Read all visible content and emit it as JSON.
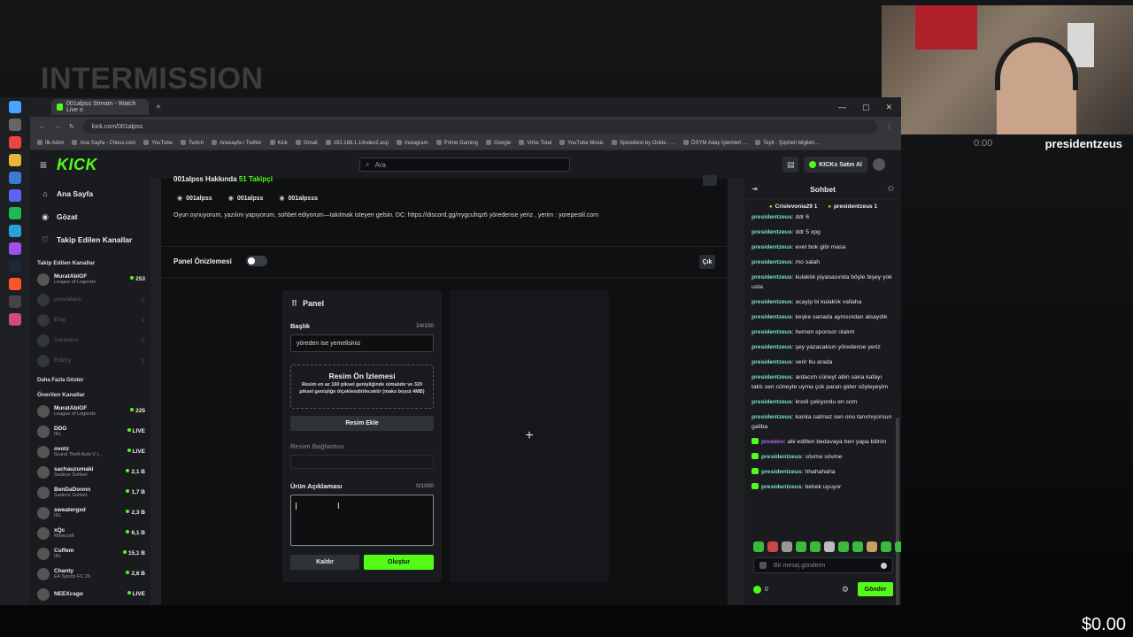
{
  "overlay": {
    "intermission": "INTERMISSION",
    "cam_time": "0:00",
    "cam_name": "presidentzeus",
    "money": "$0.00"
  },
  "browser": {
    "tab_title": "001alpss Stream - Watch Live o",
    "url": "kick.com/001alpss",
    "bookmarks": [
      "İlk Adım",
      "Ana Sayfa - Chess.com",
      "YouTube",
      "Twitch",
      "Anasayfa / Twitter",
      "Kick",
      "Gmail",
      "192.168.1.1/index2.asp",
      "Instagram",
      "Prime Gaming",
      "Google",
      "Virüs Total",
      "YouTube Music",
      "Speedtest by Ookla - ...",
      "ÖSYM Aday İşlemleri ...",
      "Teyit - Şüpheli bilgilen..."
    ]
  },
  "header": {
    "logo": "KICK",
    "search_placeholder": "Ara",
    "buy_label": "KICKs Satın Al"
  },
  "sidebar": {
    "nav": [
      {
        "icon": "⌂",
        "label": "Ana Sayfa"
      },
      {
        "icon": "◉",
        "label": "Gözat"
      },
      {
        "icon": "♡",
        "label": "Takip Edilen Kanallar"
      }
    ],
    "followed_title": "Takip Edilen Kanallar",
    "followed": [
      {
        "name": "MuratAbiGF",
        "game": "League of Legends",
        "viewers": "253",
        "live": true
      },
      {
        "name": "umurafann",
        "game": "",
        "viewers": "⚲",
        "live": false
      },
      {
        "name": "Ersy",
        "game": "",
        "viewers": "⚲",
        "live": false
      },
      {
        "name": "Saracens",
        "game": "",
        "viewers": "⚲",
        "live": false
      },
      {
        "name": "Erlizzy",
        "game": "",
        "viewers": "⚲",
        "live": false
      }
    ],
    "more": "Daha Fazla Göster",
    "recommended_title": "Önerilen Kanallar",
    "recommended": [
      {
        "name": "MuratAbiGF",
        "game": "League of Legends",
        "viewers": "225"
      },
      {
        "name": "DDG",
        "game": "IRL",
        "viewers": "LIVE"
      },
      {
        "name": "ovotz",
        "game": "Grand Theft Auto V (...",
        "viewers": "LIVE"
      },
      {
        "name": "sachauzumaki",
        "game": "Sadece Sohbet",
        "viewers": "2,1 B"
      },
      {
        "name": "BenDaDonnn",
        "game": "Sadece Sohbet",
        "viewers": "1,7 B"
      },
      {
        "name": "sweatergxd",
        "game": "IRL",
        "viewers": "2,3 B"
      },
      {
        "name": "xQc",
        "game": "Minecraft",
        "viewers": "6,1 B"
      },
      {
        "name": "Cuffem",
        "game": "IRL",
        "viewers": "15,1 B"
      },
      {
        "name": "Chanty",
        "game": "EA Sports FC 26",
        "viewers": "2,6 B"
      },
      {
        "name": "NEEXcsgo",
        "game": "",
        "viewers": "LIVE"
      }
    ]
  },
  "about": {
    "title": "001alpss Hakkında",
    "followers": "51 Takipçi",
    "socials": [
      "001alpss",
      "001alpss",
      "001alpsss"
    ],
    "bio": "Oyun oynuyorum, yazılım yapıyorum, sohbet ediyorum—takılmak isteyen gelsin. DC: https://discord.gg/rrygcuhqz6 yöredense yeriz , yerim : yorepestil.com"
  },
  "panel_preview": {
    "label": "Panel Önizlemesi",
    "exit": "Çık"
  },
  "editor": {
    "title": "Panel",
    "title_label": "Başlık",
    "title_count": "24/100",
    "title_value": "yöreden ise yemelisiniz",
    "image_preview_title": "Resim Ön İzlemesi",
    "image_preview_desc": "Resim en az 160 piksel genişliğinde olmalıdır ve 320 piksel genişliğe ölçeklendirilecektir (maks boyut 4MB)",
    "add_image": "Resim Ekle",
    "image_link_label": "Resim Bağlantısı",
    "desc_label": "Ürün Açıklaması",
    "desc_count": "0/1000",
    "remove": "Kaldır",
    "create": "Oluştur",
    "add_panel": "+"
  },
  "chat": {
    "title": "Sohbet",
    "pinned": [
      "Crislevonia29 1",
      "presidentzeus 1"
    ],
    "messages": [
      {
        "user": "presidentzeus",
        "text": "ddr 6",
        "badge": false,
        "purple": false
      },
      {
        "user": "presidentzeus",
        "text": "ddr 5 xpg",
        "badge": false,
        "purple": false
      },
      {
        "user": "presidentzeus",
        "text": "evet bok gibi masa",
        "badge": false,
        "purple": false
      },
      {
        "user": "presidentzeus",
        "text": "mo salah",
        "badge": false,
        "purple": false
      },
      {
        "user": "presidentzeus",
        "text": "kulaklık piyasasında böyle bişey yok usta",
        "badge": false,
        "purple": false
      },
      {
        "user": "presidentzeus",
        "text": "acayip bi kulaklık vallaha",
        "badge": false,
        "purple": false
      },
      {
        "user": "presidentzeus",
        "text": "keşke sanada aynısından alsaydık",
        "badge": false,
        "purple": false
      },
      {
        "user": "presidentzeus",
        "text": "hemen sponsor olalım",
        "badge": false,
        "purple": false
      },
      {
        "user": "presidentzeus",
        "text": "şey yazacaksın yöredense yeriz",
        "badge": false,
        "purple": false
      },
      {
        "user": "presidentzeus",
        "text": "verir bu arada",
        "badge": false,
        "purple": false
      },
      {
        "user": "presidentzeus",
        "text": "ardacım cüneyt abin sana kafayı taktı sen cüneyte uyma çok paran gider söyleyeyim",
        "badge": false,
        "purple": false
      },
      {
        "user": "presidentzeus",
        "text": "kredi çekiyordu en som",
        "badge": false,
        "purple": false
      },
      {
        "user": "presidentzeus",
        "text": "kanka salmaz sen onu tanımıyorsun galiba",
        "badge": false,
        "purple": false
      },
      {
        "user": "jovadov",
        "text": "abi editleri bedavaya ben yapa bilirim",
        "badge": true,
        "purple": true
      },
      {
        "user": "presidentzeus",
        "text": "sövme sövme",
        "badge": true,
        "purple": false
      },
      {
        "user": "presidentzeus",
        "text": "hhahahaha",
        "badge": true,
        "purple": false
      },
      {
        "user": "presidentzeus",
        "text": "bebek uyuyor",
        "badge": true,
        "purple": false
      }
    ],
    "input_placeholder": "Bir mesaj gönderin",
    "kicks": "0",
    "send": "Gönder"
  },
  "colors": {
    "accent": "#53fc18",
    "chat_user": "#7de2d1"
  }
}
